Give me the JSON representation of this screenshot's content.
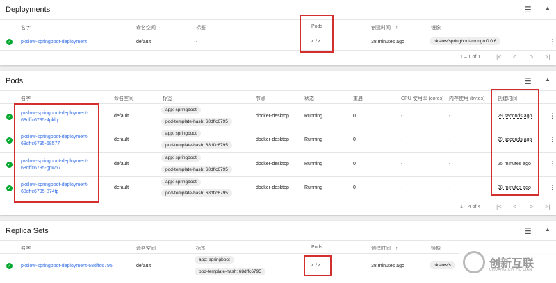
{
  "deployments": {
    "title": "Deployments",
    "columns": {
      "name": "名字",
      "namespace": "命名空间",
      "labels": "标签",
      "pods": "Pods",
      "created": "创建时间",
      "sort_arrow": "↑",
      "images": "镜像"
    },
    "rows": [
      {
        "name": "pkslow-springboot-deployment",
        "namespace": "default",
        "labels": "-",
        "pods": "4 / 4",
        "created": "38 minutes ago",
        "image": "pkslow/springboot-mongo:0.0.6"
      }
    ],
    "pager": "1 – 1 of 1"
  },
  "pods": {
    "title": "Pods",
    "columns": {
      "name": "名字",
      "namespace": "命名空间",
      "labels": "标签",
      "node": "节点",
      "status": "状态",
      "restarts": "重启",
      "cpu": "CPU 使用率 (cores)",
      "memory": "内存使用 (bytes)",
      "created": "创建时间",
      "sort_arrow": "↑"
    },
    "rows": [
      {
        "name1": "pkslow-springboot-deployment-",
        "name2": "68dffc6795-4pklq",
        "namespace": "default",
        "label1": "app: springboot",
        "label2": "pod-template-hash: 68dffc6795",
        "node": "docker-desktop",
        "status": "Running",
        "restarts": "0",
        "cpu": "-",
        "memory": "-",
        "created": "29 seconds ago"
      },
      {
        "name1": "pkslow-springboot-deployment-",
        "name2": "68dffc6795-68577",
        "namespace": "default",
        "label1": "app: springboot",
        "label2": "pod-template-hash: 68dffc6795",
        "node": "docker-desktop",
        "status": "Running",
        "restarts": "0",
        "cpu": "-",
        "memory": "-",
        "created": "29 seconds ago"
      },
      {
        "name1": "pkslow-springboot-deployment-",
        "name2": "68dffc6795-gpw67",
        "namespace": "default",
        "label1": "app: springboot",
        "label2": "pod-template-hash: 68dffc6795",
        "node": "docker-desktop",
        "status": "Running",
        "restarts": "0",
        "cpu": "-",
        "memory": "-",
        "created": "25 minutes ago"
      },
      {
        "name1": "pkslow-springboot-deployment-",
        "name2": "68dffc6795-874tp",
        "namespace": "default",
        "label1": "app: springboot",
        "label2": "pod-template-hash: 68dffc6795",
        "node": "docker-desktop",
        "status": "Running",
        "restarts": "0",
        "cpu": "-",
        "memory": "-",
        "created": "38 minutes ago"
      }
    ],
    "pager": "1 – 4 of 4"
  },
  "replicasets": {
    "title": "Replica Sets",
    "columns": {
      "name": "名字",
      "namespace": "命名空间",
      "labels": "标签",
      "pods": "Pods",
      "created": "创建时间",
      "sort_arrow": "↑",
      "images": "镜像"
    },
    "rows": [
      {
        "name": "pkslow-springboot-deployment-68dffc6795",
        "namespace": "default",
        "label1": "app: springboot",
        "label2": "pod-template-hash: 68dffc6795",
        "pods": "4 / 4",
        "created": "38 minutes ago",
        "image": "pkslow/s"
      }
    ]
  },
  "watermark": {
    "text": "创新互联",
    "sub": "CHUANG XIN HU LIAN"
  },
  "icons": {
    "filter": "filter-icon",
    "collapse": "chevron-up-icon",
    "more": "more-vert-icon",
    "status_ok": "check-circle-icon"
  },
  "colors": {
    "link": "#326de6",
    "ok": "#00a82d",
    "highlight": "#d32f2f"
  }
}
